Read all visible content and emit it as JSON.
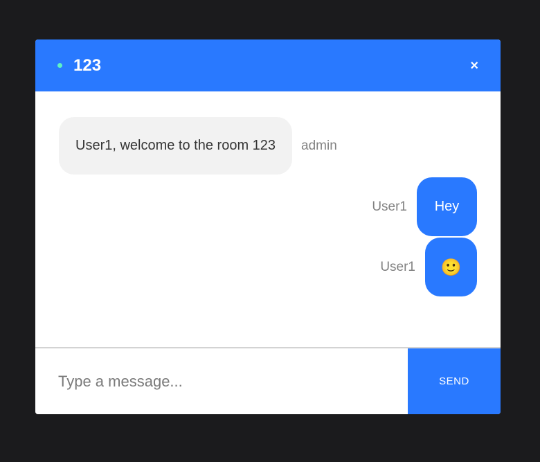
{
  "header": {
    "room_name": "123",
    "close_label": "×",
    "status_color": "#5ef2c4"
  },
  "messages": [
    {
      "text": "User1, welcome to the room 123",
      "sender": "admin",
      "side": "left"
    },
    {
      "text": "Hey",
      "sender": "User1",
      "side": "right"
    },
    {
      "text": "🙂",
      "sender": "User1",
      "side": "right"
    }
  ],
  "composer": {
    "placeholder": "Type a message...",
    "send_label": "SEND"
  },
  "colors": {
    "accent": "#2979ff",
    "background": "#1b1b1d"
  }
}
